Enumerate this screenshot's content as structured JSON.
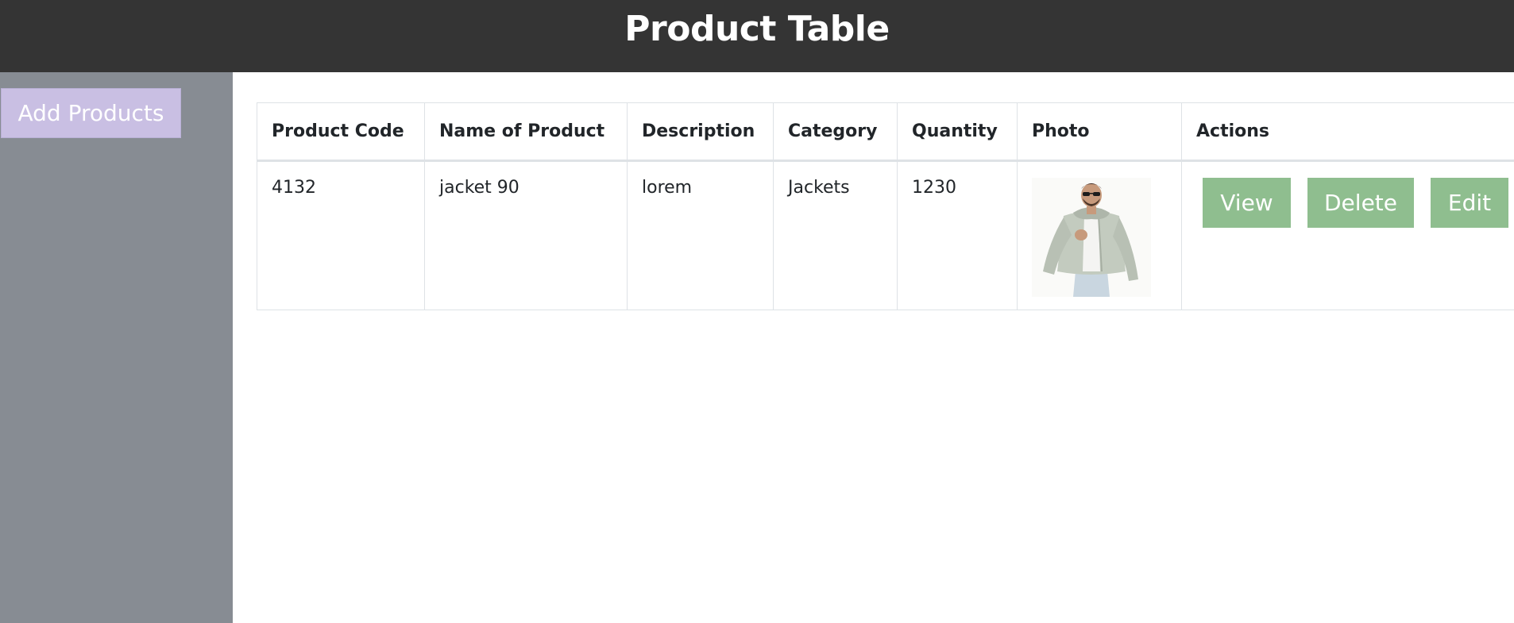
{
  "header": {
    "title": "Product Table"
  },
  "sidebar": {
    "add_button_label": "Add Products"
  },
  "table": {
    "columns": [
      "Product Code",
      "Name of Product",
      "Description",
      "Category",
      "Quantity",
      "Photo",
      "Actions"
    ],
    "rows": [
      {
        "code": "4132",
        "name": "jacket 90",
        "description": "lorem",
        "category": "Jackets",
        "quantity": "1230",
        "photo": "man-in-jacket-photo"
      }
    ]
  },
  "actions": {
    "view_label": "View",
    "delete_label": "Delete",
    "edit_label": "Edit"
  },
  "colors": {
    "header_bg": "#343434",
    "sidebar_bg": "#878c93",
    "add_button_bg": "#c9bfe3",
    "action_button_bg": "#8fbe8f"
  }
}
